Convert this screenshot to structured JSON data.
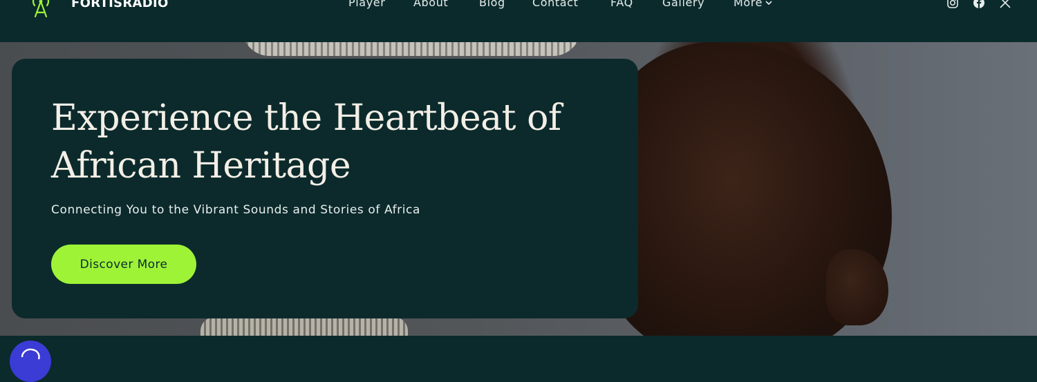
{
  "header": {
    "brand": "FORTISRADIO",
    "logo_icon": "radio-tower-icon",
    "nav": [
      {
        "label": "Player"
      },
      {
        "label": "About"
      },
      {
        "label": "Blog"
      },
      {
        "label": "Contact"
      },
      {
        "label": "FAQ"
      },
      {
        "label": "Gallery"
      },
      {
        "label": "More"
      }
    ],
    "social_icons": [
      "instagram-icon",
      "facebook-icon",
      "x-icon"
    ]
  },
  "hero": {
    "headline": "Experience the Heartbeat of African Heritage",
    "subheadline": "Connecting You to the Vibrant Sounds and Stories of Africa",
    "cta_label": "Discover More"
  },
  "colors": {
    "background": "#0b2a2c",
    "accent": "#9ef337",
    "text": "#f3efe6",
    "chat_button": "#3b3bd6"
  }
}
